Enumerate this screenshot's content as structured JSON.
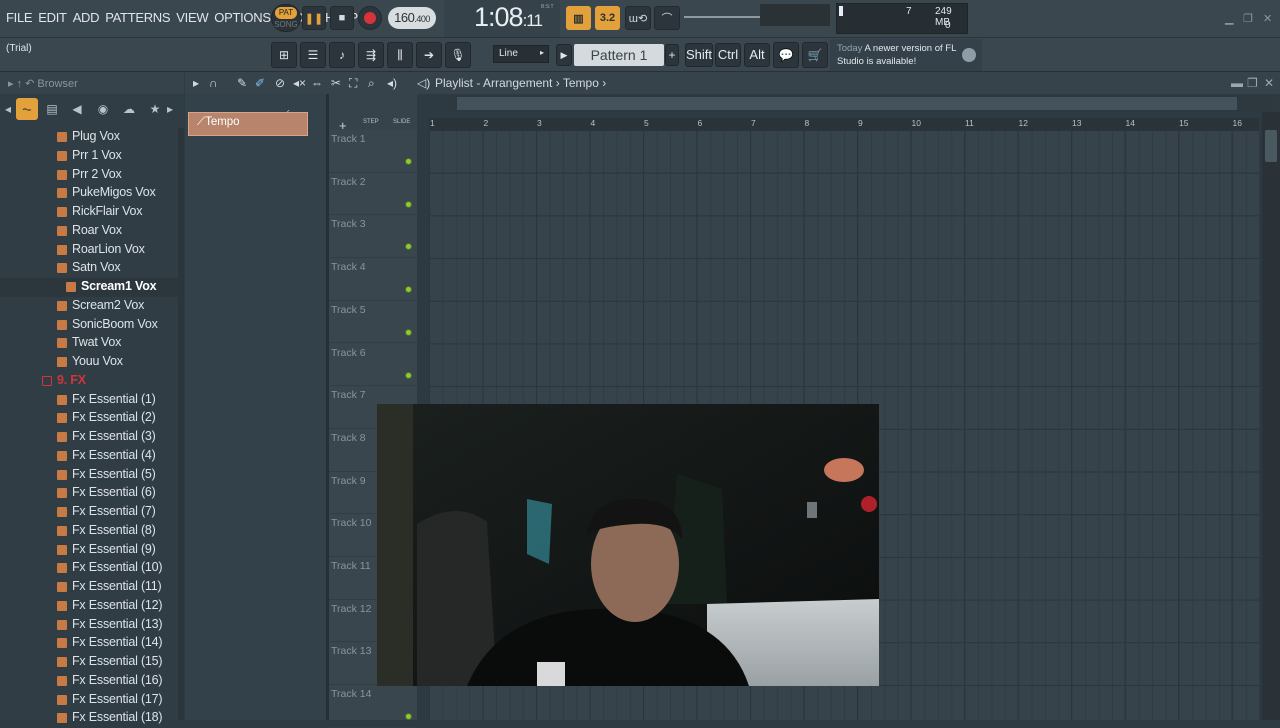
{
  "menu": [
    "FILE",
    "EDIT",
    "ADD",
    "PATTERNS",
    "VIEW",
    "OPTIONS",
    "TOOLS",
    "HELP"
  ],
  "transport": {
    "pat_label": "PAT",
    "song_label": "SONG",
    "tempo": "160",
    "tempo_decimal": ".400",
    "time_main": "1:08",
    "time_sub": ":11",
    "time_unit": "B:S:T",
    "snap_value": "3.2"
  },
  "cpu": {
    "voices": "7",
    "memory": "249 MB",
    "polyphony": "0"
  },
  "toolbar2": {
    "hint": "(Trial)",
    "snap_mode": "Line",
    "pattern": "Pattern 1",
    "keys": [
      "Shift",
      "Ctrl",
      "Alt"
    ]
  },
  "news": {
    "today": "Today",
    "message": "A newer version of FL Studio is available!"
  },
  "browser": {
    "title": "Browser",
    "items": [
      {
        "label": "Plug Vox",
        "type": "file"
      },
      {
        "label": "Prr 1 Vox",
        "type": "file"
      },
      {
        "label": "Prr 2 Vox",
        "type": "file"
      },
      {
        "label": "PukeMigos Vox",
        "type": "file"
      },
      {
        "label": "RickFlair Vox",
        "type": "file"
      },
      {
        "label": "Roar Vox",
        "type": "file"
      },
      {
        "label": "RoarLion Vox",
        "type": "file"
      },
      {
        "label": "Satn Vox",
        "type": "file"
      },
      {
        "label": "Scream1 Vox",
        "type": "selected"
      },
      {
        "label": "Scream2 Vox",
        "type": "file"
      },
      {
        "label": "SonicBoom Vox",
        "type": "file"
      },
      {
        "label": "Twat Vox",
        "type": "file"
      },
      {
        "label": "Youu Vox",
        "type": "file"
      },
      {
        "label": "9. FX",
        "type": "folder"
      },
      {
        "label": "Fx Essential (1)",
        "type": "file"
      },
      {
        "label": "Fx Essential (2)",
        "type": "file"
      },
      {
        "label": "Fx Essential (3)",
        "type": "file"
      },
      {
        "label": "Fx Essential (4)",
        "type": "file"
      },
      {
        "label": "Fx Essential (5)",
        "type": "file"
      },
      {
        "label": "Fx Essential (6)",
        "type": "file"
      },
      {
        "label": "Fx Essential (7)",
        "type": "file"
      },
      {
        "label": "Fx Essential (8)",
        "type": "file"
      },
      {
        "label": "Fx Essential (9)",
        "type": "file"
      },
      {
        "label": "Fx Essential (10)",
        "type": "file"
      },
      {
        "label": "Fx Essential (11)",
        "type": "file"
      },
      {
        "label": "Fx Essential (12)",
        "type": "file"
      },
      {
        "label": "Fx Essential (13)",
        "type": "file"
      },
      {
        "label": "Fx Essential (14)",
        "type": "file"
      },
      {
        "label": "Fx Essential (15)",
        "type": "file"
      },
      {
        "label": "Fx Essential (16)",
        "type": "file"
      },
      {
        "label": "Fx Essential (17)",
        "type": "file"
      },
      {
        "label": "Fx Essential (18)",
        "type": "file"
      }
    ]
  },
  "playlist": {
    "title": "Playlist - Arrangement",
    "breadcrumb": "Tempo",
    "clip": "Tempo",
    "step_label": "STEP",
    "slide_label": "SLIDE",
    "ruler": [
      "1",
      "2",
      "3",
      "4",
      "5",
      "6",
      "7",
      "8",
      "9",
      "10",
      "11",
      "12",
      "13",
      "14",
      "15",
      "16"
    ],
    "tracks": [
      "Track 1",
      "Track 2",
      "Track 3",
      "Track 4",
      "Track 5",
      "Track 6",
      "Track 7",
      "Track 8",
      "Track 9",
      "Track 10",
      "Track 11",
      "Track 12",
      "Track 13",
      "Track 14"
    ]
  },
  "colors": {
    "accent": "#e2a13a",
    "clip": "#b8846c",
    "folder": "#d2343a",
    "record": "#d8333a",
    "track_dot": "#8fc93a"
  }
}
